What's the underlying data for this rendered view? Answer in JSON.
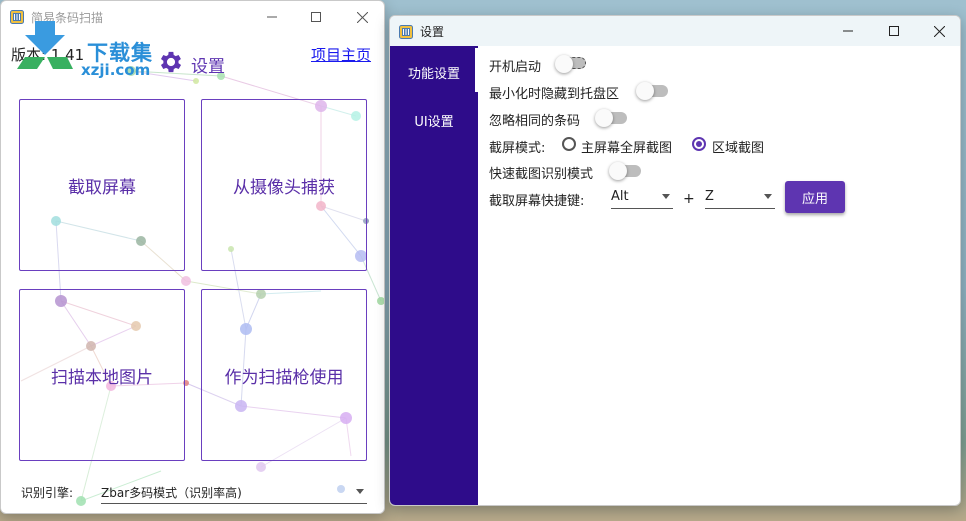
{
  "colors": {
    "accent": "#5e35b1",
    "sidebar": "#2e0c8a",
    "link": "#1a1aee"
  },
  "main_window": {
    "title": "简易条码扫描",
    "watermark": {
      "brand": "下载集",
      "site": "xzji.com"
    },
    "version": "版本: 1.41",
    "settings_label": "设置",
    "home_link": "项目主页",
    "tiles": [
      "截取屏幕",
      "从摄像头捕获",
      "扫描本地图片",
      "作为扫描枪使用"
    ],
    "engine_label": "识别引擎:",
    "engine_value": "Zbar多码模式（识别率高)"
  },
  "settings_window": {
    "title": "设置",
    "sidebar": [
      {
        "label": "功能设置",
        "active": true
      },
      {
        "label": "UI设置",
        "active": false
      }
    ],
    "options": {
      "autostart": {
        "label": "开机启动",
        "on": false
      },
      "hide_tray": {
        "label": "最小化时隐藏到托盘区",
        "on": false
      },
      "ignore_same": {
        "label": "忽略相同的条码",
        "on": false
      },
      "fast_mode": {
        "label": "快速截图识别模式",
        "on": false
      }
    },
    "capture_mode": {
      "label": "截屏模式:",
      "choices": [
        {
          "label": "主屏幕全屏截图",
          "selected": false
        },
        {
          "label": "区域截图",
          "selected": true
        }
      ]
    },
    "hotkey": {
      "label": "截取屏幕快捷键:",
      "modifier": "Alt",
      "plus": "+",
      "key": "Z",
      "apply_label": "应用"
    }
  }
}
